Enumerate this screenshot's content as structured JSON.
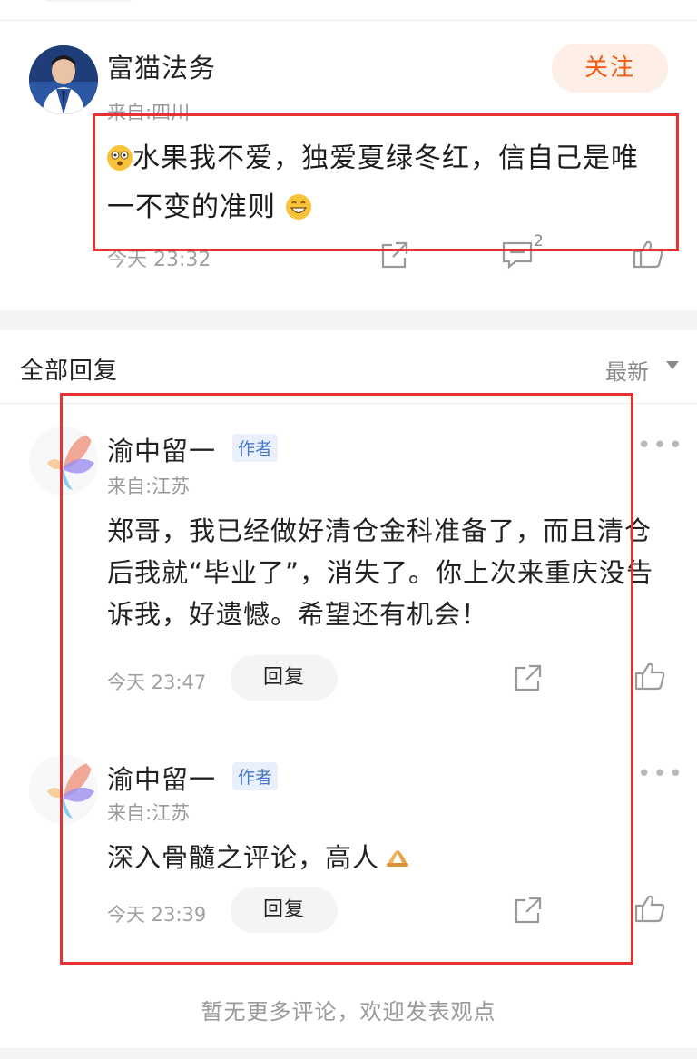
{
  "post": {
    "author": "富猫法务",
    "location": "来自:四川",
    "follow_label": "关注",
    "text_line1": "水果我不爱，独爱夏绿冬红，信自己是唯",
    "text_line2": "一不变的准则",
    "time": "今天 23:32",
    "comment_count": "2",
    "icons": [
      "share-icon",
      "comment-icon",
      "like-icon"
    ]
  },
  "replies_header": {
    "title": "全部回复",
    "sort_label": "最新"
  },
  "replies": [
    {
      "author": "渝中留一",
      "tag": "作者",
      "location": "来自:江苏",
      "text": "郑哥，我已经做好清仓金科准备了，而且清仓后我就“毕业了”，消失了。你上次来重庆没告诉我，好遗憾。希望还有机会！",
      "time": "今天 23:47",
      "reply_label": "回复"
    },
    {
      "author": "渝中留一",
      "tag": "作者",
      "location": "来自:江苏",
      "text": "深入骨髓之评论，高人",
      "time": "今天 23:39",
      "reply_label": "回复"
    }
  ],
  "footer": {
    "no_more": "暂无更多评论，欢迎发表观点"
  },
  "colors": {
    "accent": "#f25a14",
    "follow_bg": "#fdeee6",
    "highlight_box": "#e63232",
    "author_tag": "#4a78c9"
  }
}
